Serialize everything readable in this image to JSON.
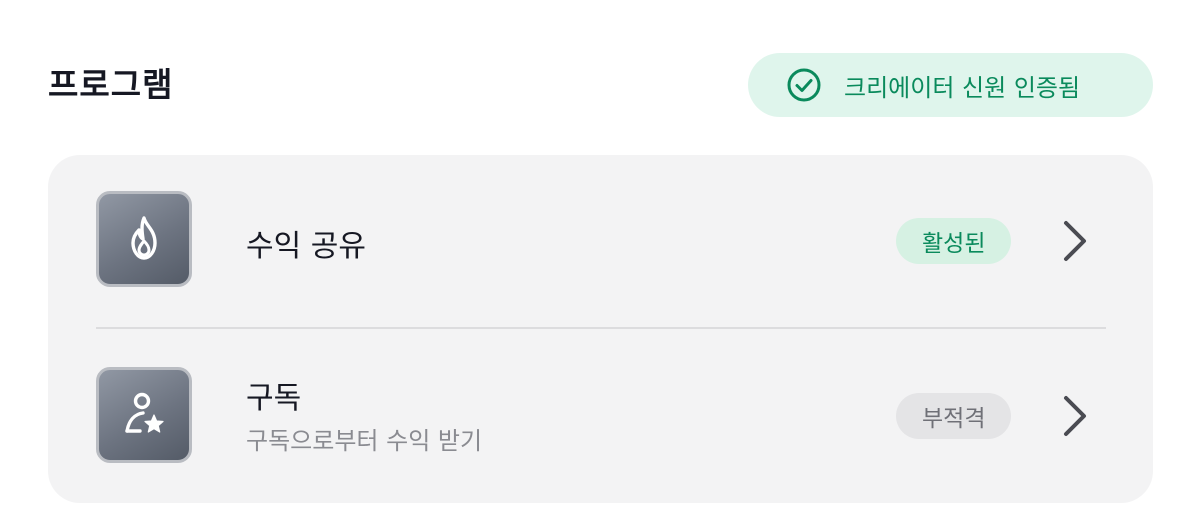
{
  "header": {
    "title": "프로그램",
    "verified_badge": {
      "text": "크리에이터 신원 인증됨",
      "icon": "check-circle-icon",
      "color": "#0a8a5c",
      "background": "#dff5ec"
    }
  },
  "programs": [
    {
      "icon": "flame-icon",
      "title": "수익 공유",
      "subtitle": "",
      "status": "활성된",
      "status_color": "#0a8a5c",
      "status_background": "#d6f1e3"
    },
    {
      "icon": "person-star-icon",
      "title": "구독",
      "subtitle": "구독으로부터 수익 받기",
      "status": "부적격",
      "status_color": "#6f7077",
      "status_background": "#e4e4e6"
    }
  ]
}
